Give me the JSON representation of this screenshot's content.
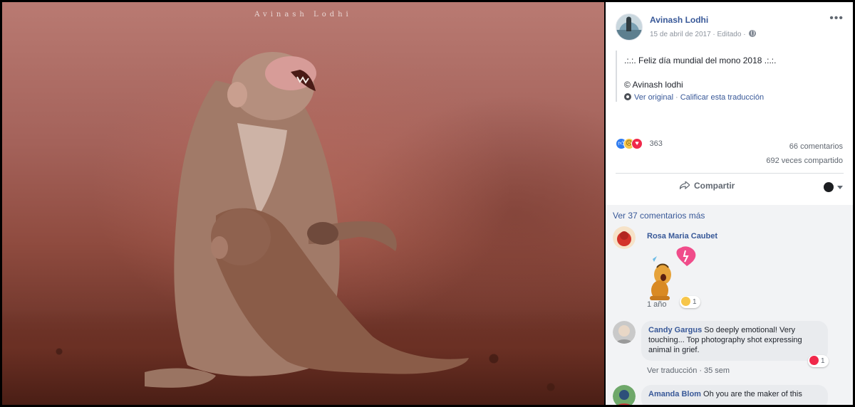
{
  "photo": {
    "watermark": "Avinash Lodhi"
  },
  "post": {
    "author": "Avinash Lodhi",
    "date": "15 de abril de 2017",
    "edited": "Editado",
    "text_line1": ".:.:. Feliz día mundial del mono 2018 .:.:.",
    "text_line2": "© Avinash lodhi",
    "see_original": "Ver original",
    "rate_translation": "Calificar esta traducción"
  },
  "reactions": {
    "count": "363",
    "comments": "66 comentarios",
    "shares": "692 veces compartido"
  },
  "actions": {
    "share_label": "Compartir"
  },
  "comments": {
    "more_label": "Ver 37 comentarios más",
    "items": [
      {
        "author": "Rosa Maria Caubet",
        "time": "1 año",
        "reaction_count": "1"
      },
      {
        "author": "Candy Gargus",
        "text": "So deeply emotional! Very touching... Top photography shot expressing animal in grief.",
        "translate": "Ver traducción",
        "time": "35 sem",
        "reaction_count": "1"
      },
      {
        "author": "Amanda Blom",
        "text": "Oh you are the maker of this"
      }
    ]
  },
  "colors": {
    "link": "#385898",
    "like": "#2e7bf0",
    "love": "#f0284a",
    "sad": "#f7c64a"
  }
}
